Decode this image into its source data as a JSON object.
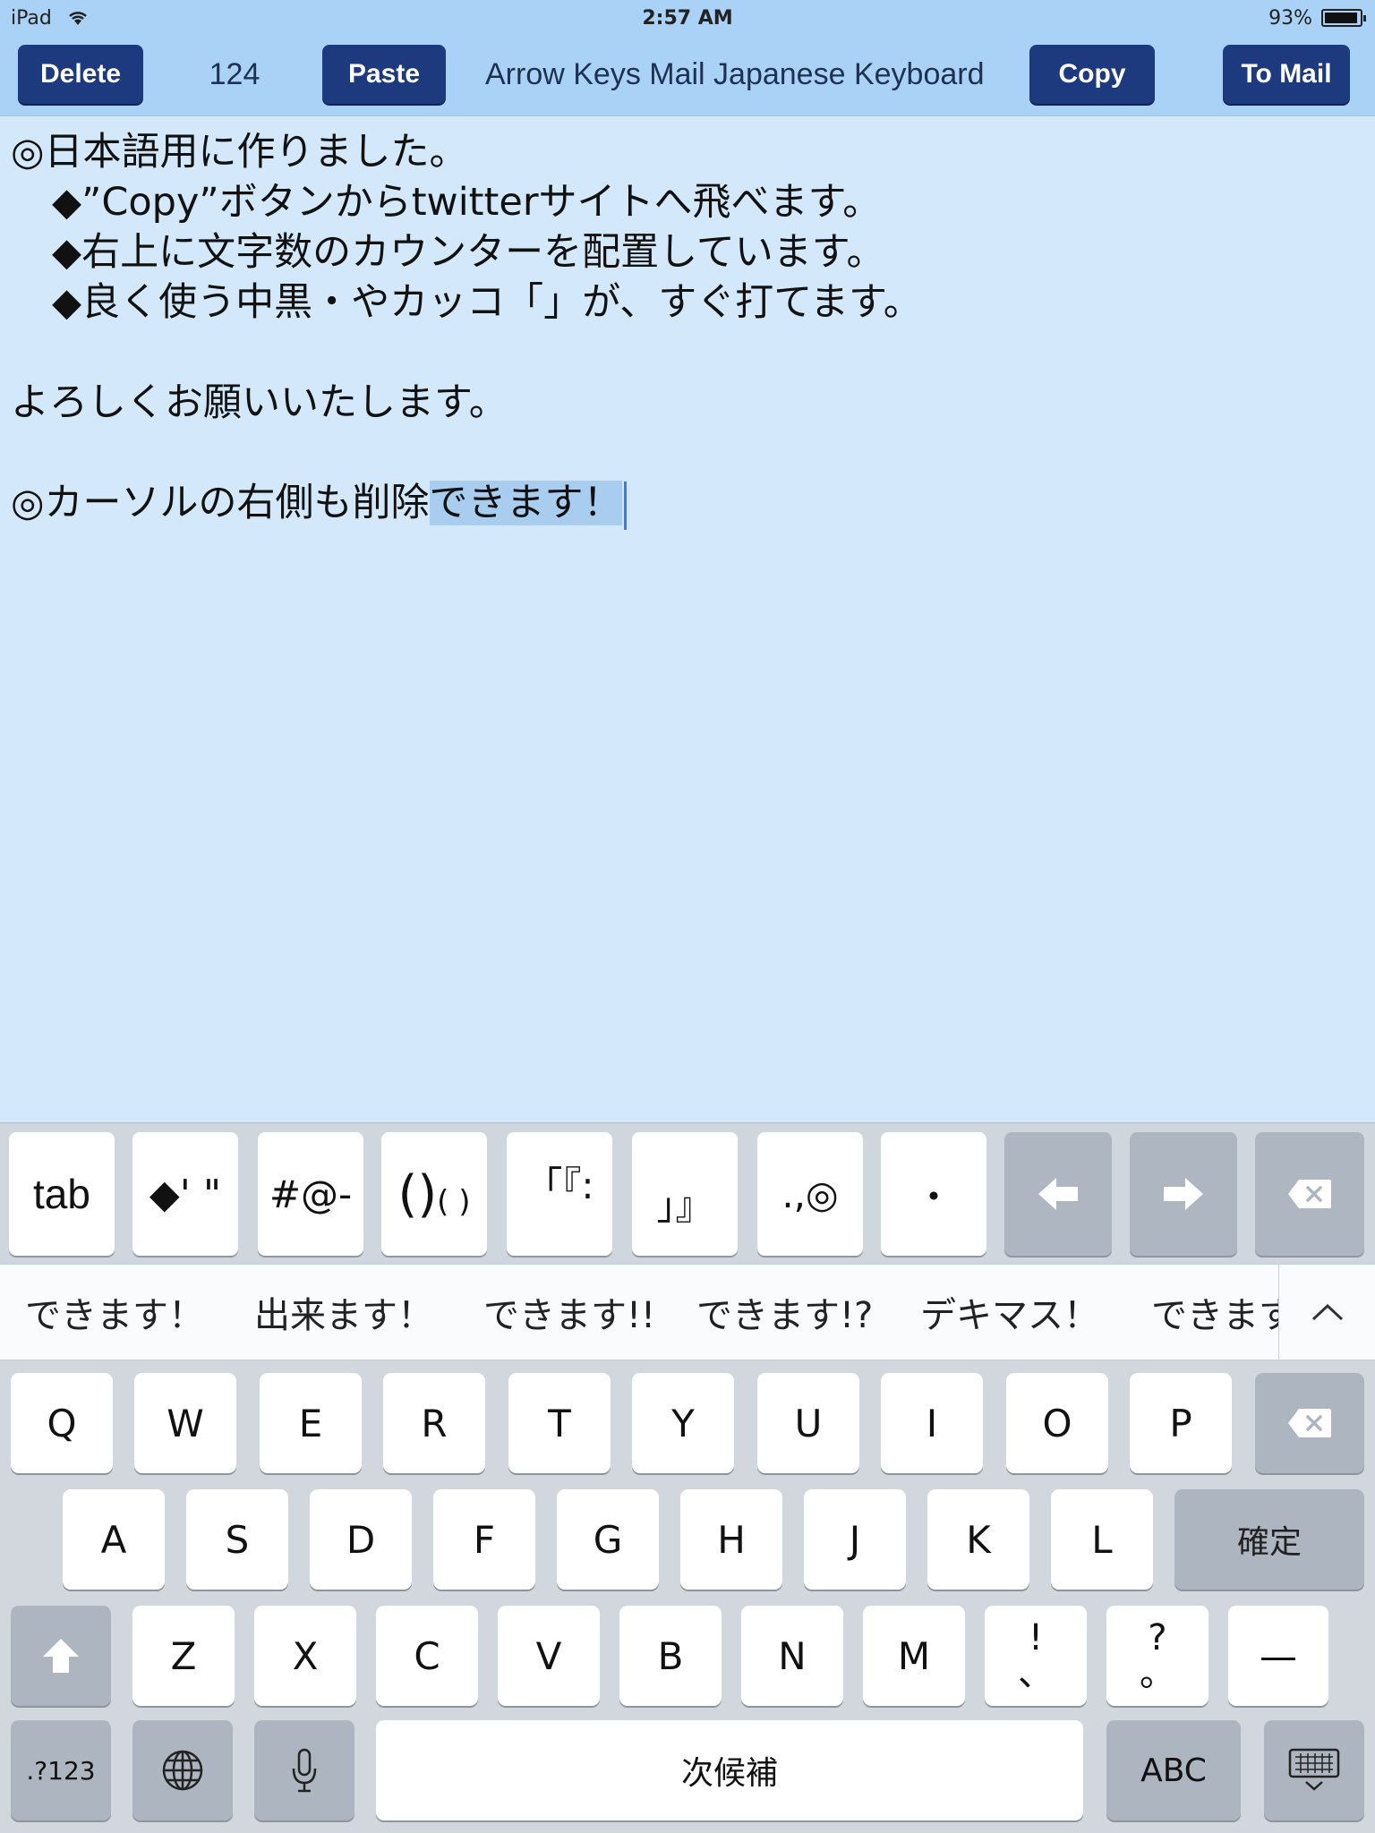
{
  "status": {
    "carrier": "iPad",
    "time": "2:57 AM",
    "battery": "93%",
    "battery_level": 0.93
  },
  "toolbar": {
    "delete_label": "Delete",
    "char_count": "124",
    "paste_label": "Paste",
    "title": "Arrow Keys Mail Japanese Keyboard",
    "copy_label": "Copy",
    "to_mail_label": "To Mail"
  },
  "editor": {
    "line1": "◎日本語用に作りました。",
    "line2": "◆”Copy”ボタンからtwitterサイトへ飛べます。",
    "line3": "◆右上に文字数のカウンターを配置しています。",
    "line4": "◆良く使う中黒・やカッコ「」が、すぐ打てます。",
    "line5": "よろしくお願いいたします。",
    "line6_pre": "◎カーソルの右側も削除",
    "line6_sel": "できます！"
  },
  "custom_keys": {
    "tab": "tab",
    "diamond_quotes": "◆' \"",
    "symbols": "#@-",
    "parens": "()",
    "parens_small": "( )",
    "brackets_open": "「『:",
    "brackets_close": "」』",
    "punct": ".,◎",
    "dot": "・"
  },
  "candidates": [
    "できます！",
    "出来ます！",
    "できます!!",
    "できます!?",
    "デキマス！",
    "できます"
  ],
  "keyboard": {
    "row1": [
      "Q",
      "W",
      "E",
      "R",
      "T",
      "Y",
      "U",
      "I",
      "O",
      "P"
    ],
    "row2": [
      "A",
      "S",
      "D",
      "F",
      "G",
      "H",
      "J",
      "K",
      "L"
    ],
    "confirm": "確定",
    "row3": [
      "Z",
      "X",
      "C",
      "V",
      "B",
      "N",
      "M"
    ],
    "exclaim_top": "!",
    "exclaim_bottom": "、",
    "question_top": "?",
    "question_bottom": "。",
    "dash": "—",
    "numbers": ".?123",
    "next_candidate": "次候補",
    "abc": "ABC"
  },
  "icons": [
    "wifi-icon",
    "battery-icon",
    "left-arrow-icon",
    "right-arrow-icon",
    "backspace-icon",
    "chevron-up-icon",
    "shift-icon",
    "globe-icon",
    "mic-icon",
    "keyboard-dismiss-icon"
  ]
}
